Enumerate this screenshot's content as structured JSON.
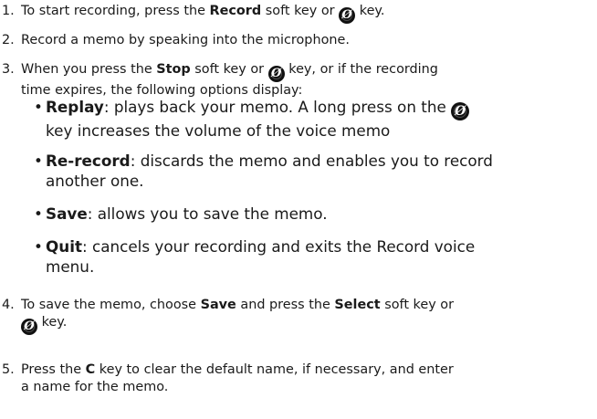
{
  "icons": {
    "power_key": "power-key-icon",
    "power_key_glyph": "Ø"
  },
  "steps": [
    {
      "number": "1.",
      "pre": "To start recording, press the ",
      "bold1": "Record",
      "mid": " soft key or ",
      "post": " key."
    },
    {
      "number": "2.",
      "text": "Record a memo by speaking into the microphone."
    },
    {
      "number": "3.",
      "pre": "When you press the ",
      "bold1": "Stop",
      "mid": " soft key or ",
      "post1": " key, or if the recording",
      "line2": "time expires, the following options display:"
    },
    {
      "number": "4.",
      "pre": "To save the memo, choose ",
      "bold1": "Save",
      "mid": " and press the ",
      "bold2": "Select",
      "post1": " soft key or",
      "post2": " key."
    },
    {
      "number": "5.",
      "pre": "Press the ",
      "bold1": "C",
      "post1": " key to clear the default name, if necessary, and enter",
      "line2": "a name for the memo."
    }
  ],
  "options": [
    {
      "bullet": "•",
      "term": "Replay",
      "line1": ": plays back your memo. A long press on the ",
      "line2": "key increases the volume of the voice memo"
    },
    {
      "bullet": "•",
      "term": "Re-record",
      "line1": ": discards the memo and enables you to record",
      "line2": "another one."
    },
    {
      "bullet": "•",
      "term": "Save",
      "line1": ": allows you to save the memo."
    },
    {
      "bullet": "•",
      "term": "Quit",
      "line1": ": cancels your recording and exits the Record voice",
      "line2": "menu."
    }
  ]
}
